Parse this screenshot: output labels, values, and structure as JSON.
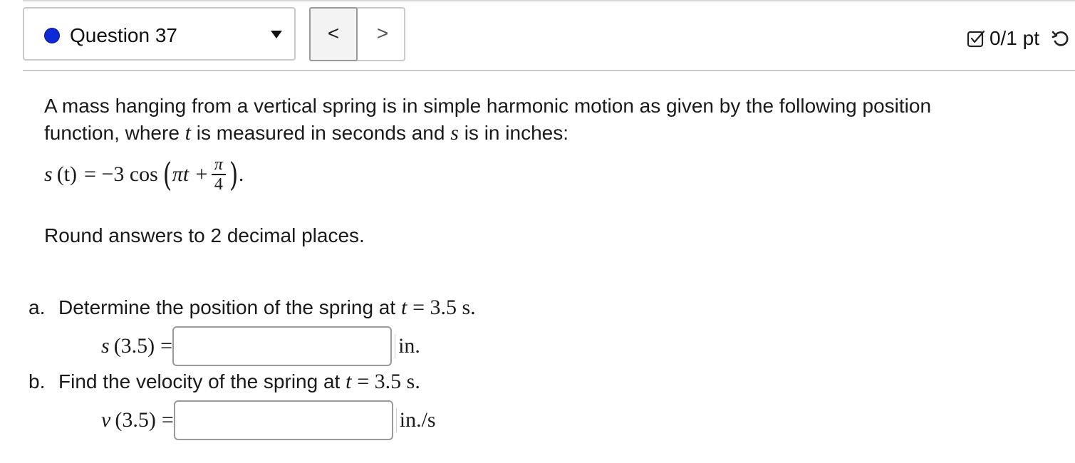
{
  "header": {
    "question_label": "Question 37",
    "prev_label": "<",
    "next_label": ">",
    "score": "0/1 pt",
    "status_color": "#0d2ad6"
  },
  "problem": {
    "intro_1": "A mass hanging from a vertical spring is in simple harmonic motion as given by the following position",
    "intro_2a": "function, where",
    "var_t": "t",
    "intro_2b": "is measured in seconds and",
    "var_s": "s",
    "intro_2c": "is in inches:",
    "formula": {
      "lhs_var": "s",
      "lhs_arg": "(t)",
      "eq": "= −3 cos",
      "inner": "πt +",
      "frac_num": "π",
      "frac_den": "4",
      "end": "."
    },
    "round_note": "Round answers to 2 decimal places."
  },
  "parts": [
    {
      "letter": "a.",
      "prompt": "Determine the position of the spring at",
      "cond_var": "t",
      "cond_val": "= 3.5 s.",
      "lhs_var": "s",
      "lhs_arg": "(3.5)",
      "eq": "=",
      "value": "",
      "unit": "in."
    },
    {
      "letter": "b.",
      "prompt": "Find the velocity of the spring at",
      "cond_var": "t",
      "cond_val": "= 3.5 s.",
      "lhs_var": "v",
      "lhs_arg": "(3.5)",
      "eq": "=",
      "value": "",
      "unit": "in./s"
    }
  ]
}
